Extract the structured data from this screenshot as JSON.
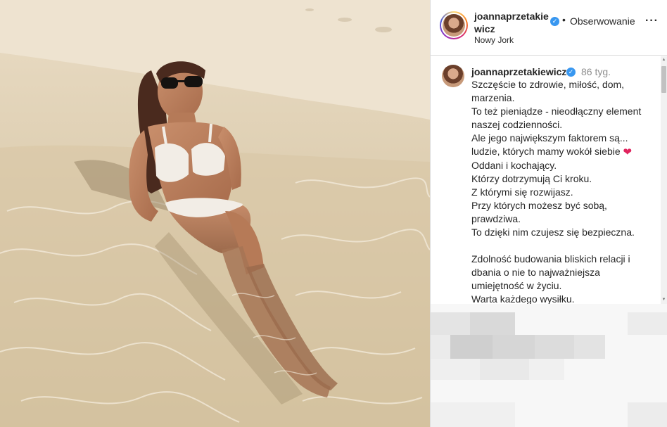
{
  "header": {
    "username": "joannaprzetakiewicz",
    "verified_icon": "verified-badge-icon",
    "separator": "•",
    "follow_label": "Obserwowanie",
    "more_icon": "more-options-icon",
    "location": "Nowy Jork"
  },
  "comment": {
    "username": "joannaprzetakiewicz",
    "time": "86 tyg.",
    "caption_lines": [
      "Szczęście to zdrowie, miłość, dom,",
      "marzenia.",
      "To też pieniądze - nieodłączny element",
      "naszej codzienności.",
      "Ale jego największym faktorem są...",
      "ludzie, których mamy wokół siebie",
      "Oddani i kochający.",
      "Którzy dotrzymują Ci kroku.",
      "Z którymi się rozwijasz.",
      "Przy których możesz być sobą,",
      "prawdziwa.",
      "To dzięki nim czujesz się bezpieczna.",
      "",
      "Zdolność budowania bliskich relacji i",
      "dbania o nie to najważniejsza",
      "umiejętność w życiu.",
      "Warta każdego wysiłku."
    ],
    "heart_emoji": "❤"
  },
  "colors": {
    "accent_verified": "#3897f0",
    "heart": "#e0245e",
    "text": "#262626",
    "muted": "#8e8e8e"
  }
}
